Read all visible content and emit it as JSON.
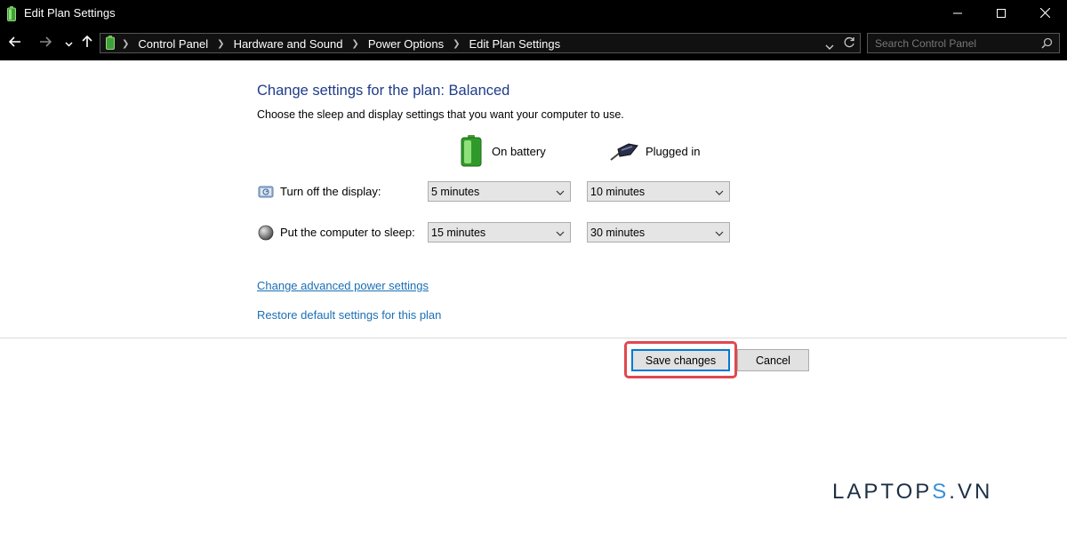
{
  "window": {
    "title": "Edit Plan Settings",
    "app_icon": "battery-icon",
    "controls": [
      "minimize-icon",
      "maximize-icon",
      "close-icon"
    ]
  },
  "nav": {
    "back_icon": "back-arrow-icon",
    "forward_icon": "forward-arrow-icon",
    "recent_icon": "chevron-down-icon",
    "up_icon": "up-arrow-icon",
    "breadcrumbs": [
      "Control Panel",
      "Hardware and Sound",
      "Power Options",
      "Edit Plan Settings"
    ],
    "search_placeholder": "Search Control Panel"
  },
  "main": {
    "title": "Change settings for the plan: Balanced",
    "subtitle": "Choose the sleep and display settings that you want your computer to use.",
    "columns": [
      "On battery",
      "Plugged in"
    ],
    "rows": [
      {
        "label": "Turn off the display:",
        "icon": "display-icon",
        "battery": "5 minutes",
        "plugged": "10 minutes"
      },
      {
        "label": "Put the computer to sleep:",
        "icon": "sleep-moon-icon",
        "battery": "15 minutes",
        "plugged": "30 minutes"
      }
    ],
    "links": {
      "advanced": "Change advanced power settings",
      "restore": "Restore default settings for this plan"
    }
  },
  "buttons": {
    "save": "Save changes",
    "cancel": "Cancel"
  },
  "watermark": {
    "part1": "LAPTOP",
    "part2": "S",
    "part3": ".VN"
  },
  "colors": {
    "title_blue": "#1f3c88",
    "link_blue": "#1a6fb5",
    "highlight_red": "#e0484f",
    "focus_blue": "#0078d7"
  }
}
